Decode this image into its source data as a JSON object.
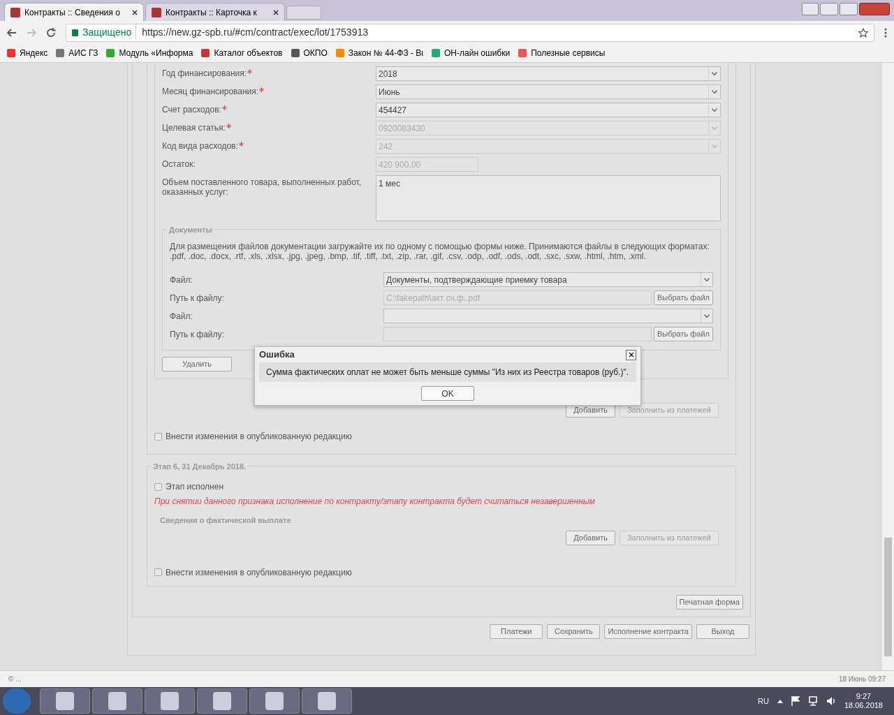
{
  "browser": {
    "tabs": [
      {
        "title": "Контракты :: Сведения о",
        "selected": true
      },
      {
        "title": "Контракты :: Карточка к",
        "selected": false
      }
    ],
    "secure_label": "Защищено",
    "url": "https://new.gz-spb.ru/#cm/contract/exec/lot/1753913",
    "bookmarks": [
      "Яндекс",
      "АИС ГЗ",
      "Модуль «Информа",
      "Каталог объектов",
      "ОКПО",
      "Закон № 44-ФЗ - Вι",
      "ОН-лайн ошибки",
      "Полезные сервисы"
    ]
  },
  "form": {
    "fields": [
      {
        "label": "Год финансирования:",
        "required": true,
        "kind": "select",
        "value": "2018",
        "disabled": false
      },
      {
        "label": "Месяц финансирования:",
        "required": true,
        "kind": "select",
        "value": "Июнь",
        "disabled": false
      },
      {
        "label": "Счет расходов:",
        "required": true,
        "kind": "select",
        "value": "454427",
        "disabled": false
      },
      {
        "label": "Целевая статья:",
        "required": true,
        "kind": "select",
        "value": "0920083430",
        "disabled": true
      },
      {
        "label": "Код вида расходов:",
        "required": true,
        "kind": "select",
        "value": "242",
        "disabled": true
      },
      {
        "label": "Остаток:",
        "required": false,
        "kind": "input",
        "value": "420 900,00",
        "disabled": true
      },
      {
        "label": "Объем поставленного товара, выполненных работ, оказанных услуг:",
        "required": false,
        "kind": "textarea",
        "value": "1 мес",
        "disabled": false
      }
    ],
    "documents": {
      "legend": "Документы",
      "hint": "Для размещения файлов документации загружайте их по одному с помощью формы ниже. Принимаются файлы в следующих форматах: .pdf, .doc, .docx, .rtf, .xls, .xlsx, .jpg, .jpeg, .bmp, .tif, .tiff, .txt, .zip, .rar, .gif, .csv, .odp, .odf, .ods, .odt, .sxc, .sxw, .html, .htm, .xml.",
      "rows": [
        {
          "kind": "select",
          "label": "Файл:",
          "value": "Документы, подтверждающие приемку товара"
        },
        {
          "kind": "path",
          "label": "Путь к файлу:",
          "value": "C:\\fakepath\\акт сч.ф..pdf",
          "button": "Выбрать файл"
        },
        {
          "kind": "select",
          "label": "Файл:"
        },
        {
          "kind": "path",
          "label": "Путь к файлу:",
          "button": "Выбрать файл"
        }
      ]
    },
    "delete_button": "Удалить",
    "buttons": [
      {
        "label": "Добавить",
        "disabled": false
      },
      {
        "label": "Заполнить из платежей",
        "disabled": true
      }
    ],
    "publish": {
      "label": "Внести изменения в опубликованную редакцию",
      "checked": false
    }
  },
  "stage": {
    "legend": "Этап 6, 31 Декабрь 2018.",
    "executed": {
      "label": "Этап исполнен",
      "checked": false
    },
    "warning": "При снятии данного признака исполнение по контракту/этапу контракта будет считаться незавершенным",
    "subheading": "Сведения о фактической выплате",
    "buttons": [
      {
        "label": "Добавить",
        "disabled": false
      },
      {
        "label": "Заполнить из платежей",
        "disabled": true
      }
    ],
    "publish": {
      "label": "Внести изменения в опубликованную редакцию",
      "checked": false
    }
  },
  "print_button": "Печатная форма",
  "footer_buttons": [
    "Платежи",
    "Сохранить",
    "Исполнение контракта",
    "Выход"
  ],
  "dialog": {
    "title": "Ошибка",
    "message": "Сумма фактических оплат не может быть меньше суммы \"Из них из Реестра товаров (руб.)\".",
    "ok": "OK"
  },
  "status_bar": {
    "left": "© ...",
    "right": "18 Июнь 09:27"
  },
  "taskbar": {
    "language": "RU",
    "time": "9:27",
    "date": "18.06.2018"
  }
}
